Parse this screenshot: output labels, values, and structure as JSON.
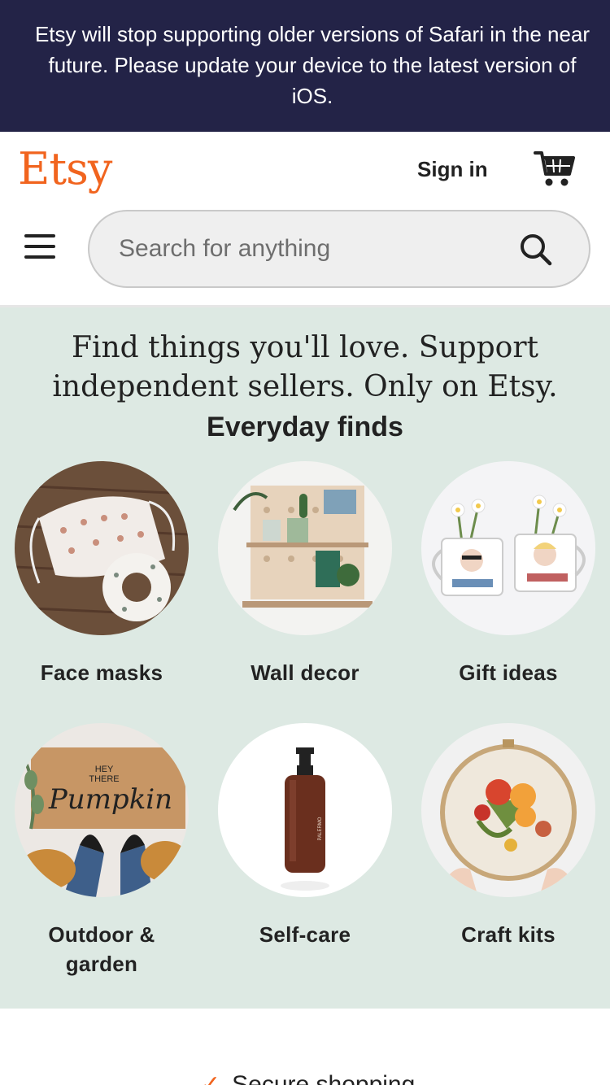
{
  "banner": {
    "text": "Etsy will stop supporting older versions of Safari in the near future. Please update your device to the latest version of iOS."
  },
  "header": {
    "logo": "Etsy",
    "sign_in": "Sign in",
    "cart_icon": "shopping-cart-icon",
    "menu_icon": "hamburger-menu-icon"
  },
  "search": {
    "placeholder": "Search for anything",
    "value": "",
    "icon": "search-icon"
  },
  "hero": {
    "tagline": "Find things you'll love. Support independent sellers. Only on Etsy.",
    "section_title": "Everyday finds"
  },
  "categories": [
    {
      "label": "Face masks"
    },
    {
      "label": "Wall decor"
    },
    {
      "label": "Gift ideas"
    },
    {
      "label": "Outdoor & garden"
    },
    {
      "label": "Self-care"
    },
    {
      "label": "Craft kits"
    }
  ],
  "footer_strip": {
    "check_icon": "checkmark-icon",
    "text": "Secure shopping"
  },
  "colors": {
    "brand": "#f1641e",
    "banner_bg": "#232347",
    "hero_bg": "#dde9e3"
  }
}
